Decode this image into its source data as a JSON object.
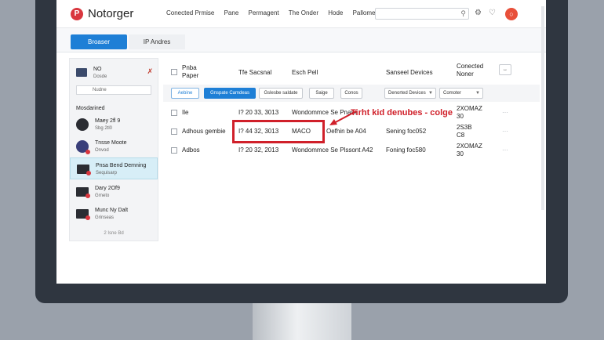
{
  "app": {
    "logo_letter": "P",
    "title": "Notorger"
  },
  "nav": [
    "Conected Prmise",
    "Pane",
    "Permagent",
    "The Onder",
    "Hode",
    "Pallome"
  ],
  "search": {
    "placeholder": ""
  },
  "header_icons": [
    "search-icon",
    "gear-icon",
    "bell-icon"
  ],
  "tabs": [
    {
      "label": "Broaser",
      "active": true
    },
    {
      "label": "IP Andres",
      "active": false
    }
  ],
  "sidebar": {
    "top": {
      "title": "NO",
      "subtitle": "Dosde"
    },
    "search_placeholder": "Nudne",
    "section_title": "Mosdarined",
    "items": [
      {
        "name": "Maey 2fl 9",
        "sub": "Sbg 2tl0"
      },
      {
        "name": "Tnsse Moote",
        "sub": "Onvod"
      },
      {
        "name": "Pnsa Bend Demning",
        "sub": "Sequisarp"
      },
      {
        "name": "Dary 2Of9",
        "sub": "Grneto"
      },
      {
        "name": "Munc Ny Dalt",
        "sub": "Grinseas"
      }
    ],
    "footer": "2 Isne Bd"
  },
  "table": {
    "headers": {
      "col1_line1": "Pnba",
      "col1_line2": "Paper",
      "col2": "Tfe Sacsnal",
      "col3": "Esch Pell",
      "col4": "Sanseel Devices",
      "col5_line1": "Conected",
      "col5_line2": "Noner"
    },
    "filters": {
      "btn1": "Aebine",
      "btn2": "Gnspate Camdeas",
      "btn3": "Gslesbe saldate",
      "btn4": "Saige",
      "btn5": "Conos",
      "select1": "Denorted Devices",
      "select2": "Comoter"
    },
    "rows": [
      {
        "c1": "Ile",
        "c2": "I? 20 33, 3013",
        "c3": "Wondommce Se Pnase",
        "c4": "Sening foc052",
        "c5_line1": "2XOMAZ",
        "c5_line2": "30"
      },
      {
        "c1": "Adhous gembie",
        "c2": "I? 44 32, 3013",
        "c3": "MACO",
        "c3b": "Oefhin be A04",
        "c4": "Sening foc052",
        "c5_line1": "2S3B",
        "c5_line2": "C8"
      },
      {
        "c1": "Adbos",
        "c2": "I? 20 32, 2013",
        "c3": "Wondommce Se Plssont A42",
        "c4": "Foning foc580",
        "c5_line1": "2XOMAZ",
        "c5_line2": "30"
      }
    ]
  },
  "annotation": {
    "text": "Tirht kid denubes - colge"
  },
  "colors": {
    "accent": "#1e7fd6",
    "highlight": "#d0202a",
    "logo": "#d9363e"
  }
}
